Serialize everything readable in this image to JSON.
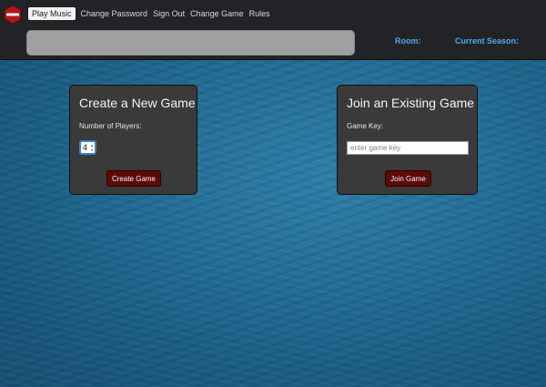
{
  "nav": {
    "logo_icon": "red-hexagon-logo-icon",
    "brand_color": "#b01818",
    "links": [
      {
        "label": "Play Music",
        "active": true
      },
      {
        "label": "Change Password",
        "active": false
      },
      {
        "label": "Sign Out",
        "active": false
      },
      {
        "label": "Change Game",
        "active": false
      },
      {
        "label": "Rules",
        "active": false
      }
    ],
    "search_value": "",
    "room_label": "Room:",
    "season_label": "Current Season:",
    "label_color": "#5aa3e8"
  },
  "create_game": {
    "title": "Create a New Game",
    "players_label": "Number of Players:",
    "players_value": "4",
    "button_label": "Create Game"
  },
  "join_game": {
    "title": "Join an Existing Game",
    "key_label": "Game Key:",
    "key_placeholder": "enter game key",
    "key_value": "",
    "button_label": "Join Game"
  },
  "colors": {
    "navbar_bg": "#222326",
    "panel_bg": "#3a3a3a",
    "button_bg": "#5e0a0a",
    "ocean": "#246f97"
  }
}
